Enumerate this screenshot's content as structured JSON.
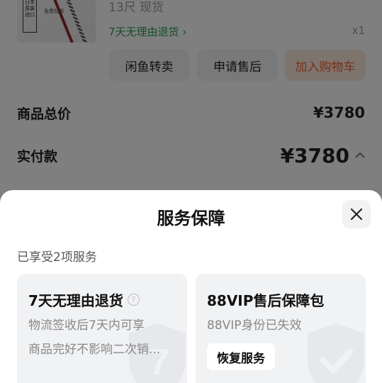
{
  "product": {
    "spec": "13尺 现货",
    "returns_label": "7天无理由退货",
    "quantity": "x1",
    "thumbnail_text": "日本原装进口",
    "thumbnail_stamp": "免费包邮"
  },
  "actions": {
    "resell": "闲鱼转卖",
    "after_sale": "申请售后",
    "add_to_cart": "加入购物车"
  },
  "summary": {
    "total_label": "商品总价",
    "total_value": "¥3780",
    "paid_label": "实付款",
    "paid_value": "¥3780"
  },
  "sheet": {
    "title": "服务保障",
    "subtitle": "已享受2项服务",
    "cards": [
      {
        "title": "7天无理由退货",
        "line1": "物流签收后7天内可享",
        "line2": "商品完好不影响二次销..."
      },
      {
        "title": "88VIP售后保障包",
        "line1": "88VIP身份已失效",
        "button": "恢复服务"
      }
    ]
  },
  "colors": {
    "green": "#2e9a55",
    "orange": "#f0623a",
    "cart_bg": "#fde8dc"
  }
}
